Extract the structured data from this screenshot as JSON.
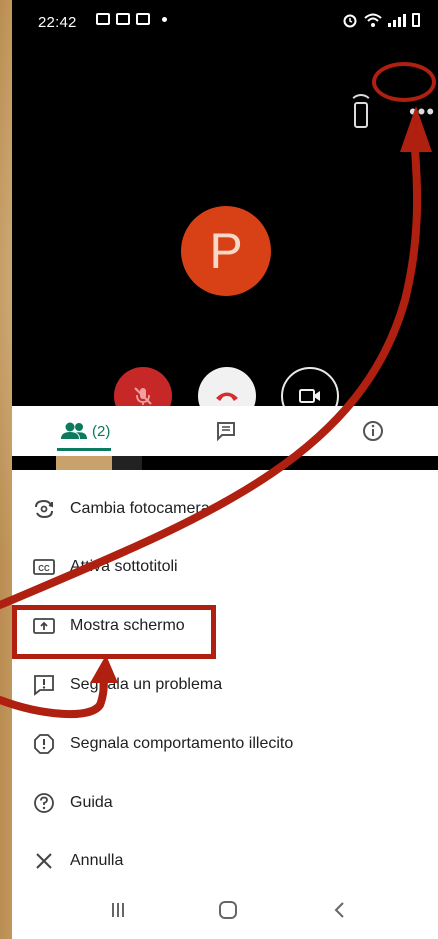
{
  "status_bar": {
    "time": "22:42",
    "icons": [
      "image-icon",
      "mail-icon",
      "mail-icon",
      "dot-icon"
    ],
    "right_icons": [
      "alarm-icon",
      "wifi-icon",
      "signal-icon",
      "battery-icon"
    ]
  },
  "call": {
    "avatar_letter": "P",
    "top_icons": [
      "cast-icon",
      "more-options-icon"
    ],
    "more_label": "•••",
    "controls": [
      {
        "name": "mic-off-button",
        "icon": "mic-off-icon"
      },
      {
        "name": "hang-up-button",
        "icon": "phone-hangup-icon"
      },
      {
        "name": "camera-button",
        "icon": "video-camera-icon"
      }
    ]
  },
  "tabs": [
    {
      "name": "people",
      "icon": "people-icon",
      "label": "(2)",
      "selected": true
    },
    {
      "name": "chat",
      "icon": "chat-icon",
      "label": "",
      "selected": false
    },
    {
      "name": "info",
      "icon": "info-icon",
      "label": "",
      "selected": false
    }
  ],
  "menu": {
    "items": [
      {
        "icon": "switch-camera-icon",
        "label": "Cambia fotocamera"
      },
      {
        "icon": "captions-icon",
        "label": "Attiva sottotitoli"
      },
      {
        "icon": "present-screen-icon",
        "label": "Mostra schermo"
      },
      {
        "icon": "report-problem-icon",
        "label": "Segnala un problema"
      },
      {
        "icon": "report-abuse-icon",
        "label": "Segnala comportamento illecito"
      },
      {
        "icon": "help-icon",
        "label": "Guida"
      },
      {
        "icon": "close-icon",
        "label": "Annulla"
      }
    ]
  },
  "nav_bar": {
    "buttons": [
      "recents-icon",
      "home-icon",
      "back-icon"
    ]
  },
  "colors": {
    "annotation": "#b02010",
    "accent": "#0b7a5e",
    "avatar": "#d84115",
    "mic_off": "#c62828"
  }
}
